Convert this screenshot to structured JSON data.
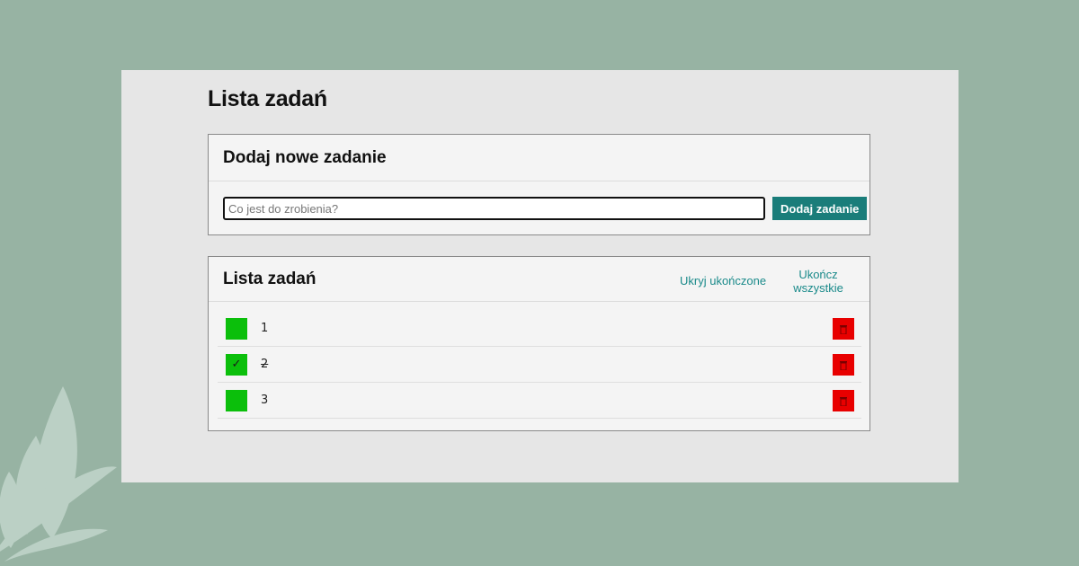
{
  "page": {
    "title": "Lista zadań"
  },
  "add_card": {
    "title": "Dodaj nowe zadanie",
    "input_placeholder": "Co jest do zrobienia?",
    "input_value": "",
    "button_label": "Dodaj zadanie"
  },
  "list_card": {
    "title": "Lista zadań",
    "hide_completed_label": "Ukryj ukończone",
    "complete_all_label": "Ukończ wszystkie",
    "tasks": [
      {
        "text": "1",
        "done": false,
        "check_glyph": ""
      },
      {
        "text": "2",
        "done": true,
        "check_glyph": "✓"
      },
      {
        "text": "3",
        "done": false,
        "check_glyph": ""
      }
    ]
  },
  "colors": {
    "background": "#97b3a3",
    "accent": "#1a7d7a",
    "check": "#0bbf0b",
    "delete": "#e80000"
  },
  "icons": {
    "check": "checkmark-icon",
    "delete": "trash-icon",
    "decoration": "leaf-icon"
  }
}
